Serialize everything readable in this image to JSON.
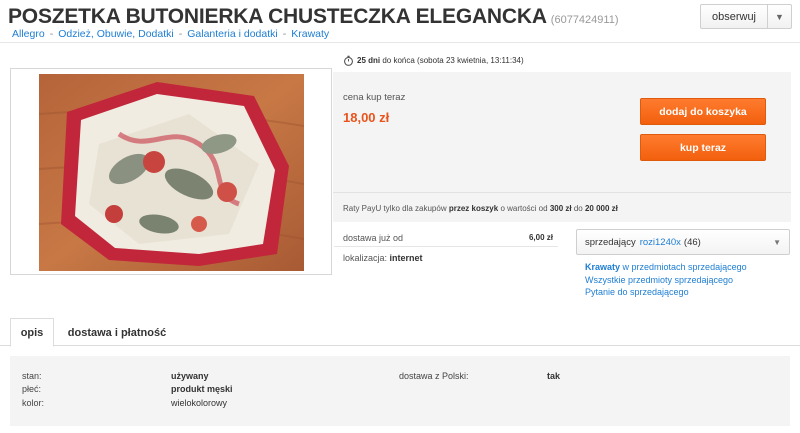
{
  "header": {
    "title": "POSZETKA BUTONIERKA CHUSTECZKA ELEGANCKA",
    "offer_id": "(6077424911)",
    "watch_label": "obserwuj",
    "watch_icon": "chevron-down-icon"
  },
  "breadcrumb": [
    "Allegro",
    "Odzież, Obuwie, Dodatki",
    "Galanteria i dodatki",
    "Krawaty"
  ],
  "timer": {
    "days": "25 dni",
    "text": "do końca (sobota 23 kwietnia, 13:11:34)",
    "icon": "stopwatch-icon"
  },
  "buy": {
    "price_label": "cena kup teraz",
    "price": "18,00 zł",
    "add_to_cart": "dodaj do koszyka",
    "buy_now": "kup teraz",
    "accent_color": "#f26a1b",
    "price_color": "#e8541c"
  },
  "payu": {
    "prefix": "Raty PayU tylko dla zakupów",
    "bold1": "przez koszyk",
    "middle": "o wartości od",
    "bold2": "300 zł",
    "middle2": "do",
    "bold3": "20 000 zł"
  },
  "delivery": {
    "label": "dostawa już od",
    "amount": "6,00 zł",
    "location_label": "lokalizacja:",
    "location_value": "internet"
  },
  "seller": {
    "label": "sprzedający",
    "nick": "rozi1240x",
    "rating": "(46)",
    "link1_bold": "Krawaty",
    "link1_rest": "w przedmiotach sprzedającego",
    "link2": "Wszystkie przedmioty sprzedającego",
    "link3": "Pytanie do sprzedającego"
  },
  "tabs": {
    "opis": "opis",
    "delivery": "dostawa i płatność"
  },
  "details": {
    "stan_label": "stan:",
    "stan_value": "używany",
    "plec_label": "płeć:",
    "plec_value": "produkt męski",
    "kolor_label": "kolor:",
    "kolor_value": "wielokolorowy",
    "ship_label": "dostawa z Polski:",
    "ship_value": "tak"
  }
}
